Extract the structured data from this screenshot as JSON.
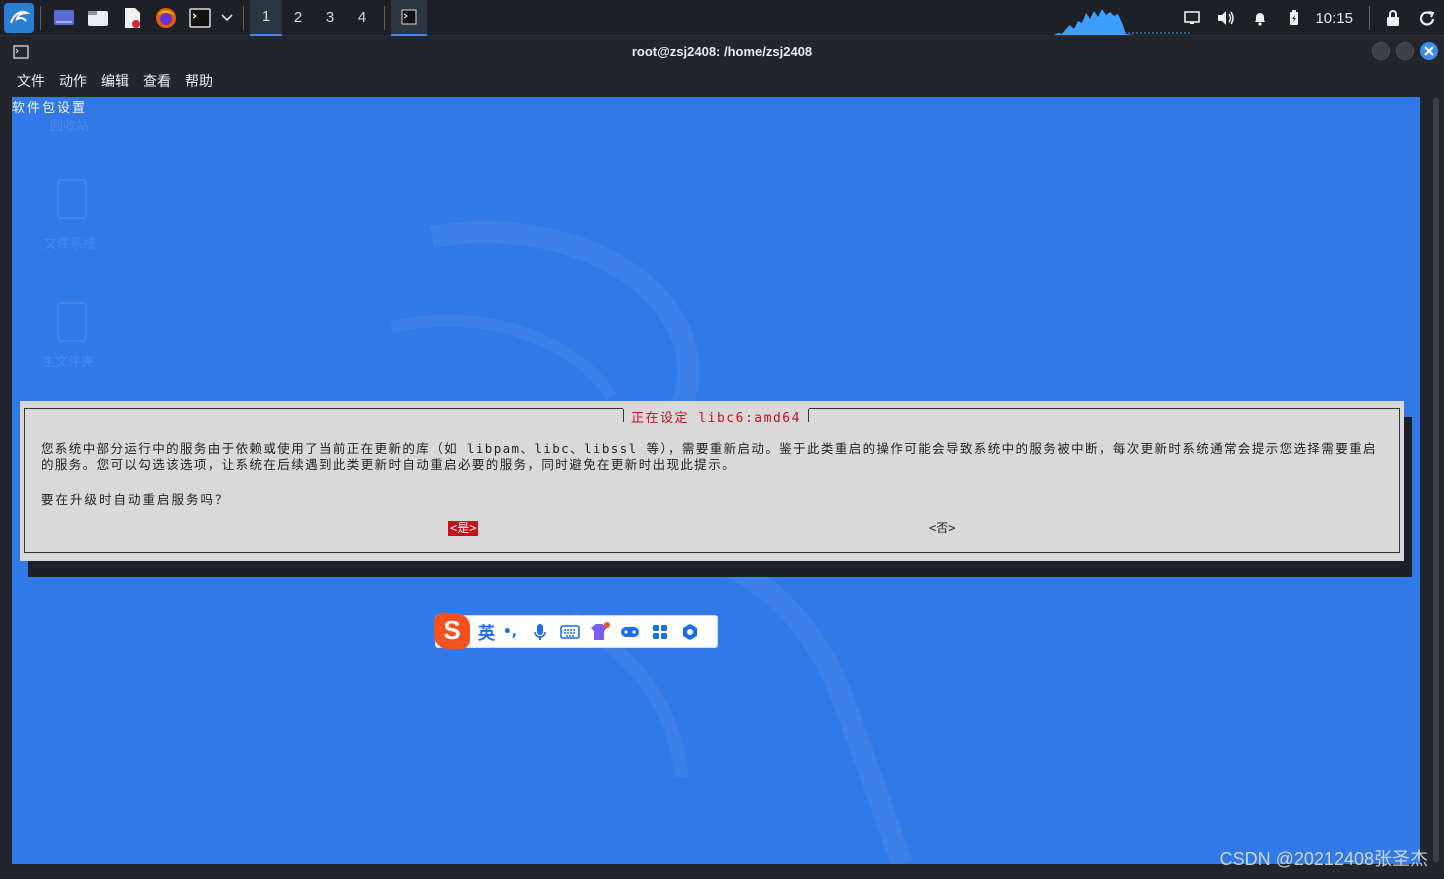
{
  "taskbar": {
    "workspaces": [
      "1",
      "2",
      "3",
      "4"
    ],
    "active_workspace": "1",
    "clock": "10:15",
    "icons": [
      "kali-menu-icon",
      "show-desktop-icon",
      "file-manager-icon",
      "text-editor-icon",
      "firefox-icon",
      "terminal-icon",
      "chevron-down-icon",
      "network-icon",
      "volume-icon",
      "notification-bell-icon",
      "battery-icon",
      "lock-icon",
      "logout-icon"
    ]
  },
  "window": {
    "title": "root@zsj2408: /home/zsj2408",
    "menu": [
      "文件",
      "动作",
      "编辑",
      "查看",
      "帮助"
    ]
  },
  "terminal": {
    "header": "软件包设置",
    "ghost_desktop": [
      "回收站",
      "文件系统",
      "主文件夹"
    ],
    "background_color": "#3279e8"
  },
  "dialog": {
    "title": "正在设定 libc6:amd64",
    "body": "您系统中部分运行中的服务由于依赖或使用了当前正在更新的库（如 libpam、libc、libssl 等），需要重新启动。鉴于此类重启的操作可能会导致系统中的服务被中断，每次更新时系统通常会提示您选择需要重启的服务。您可以勾选该选项，让系统在后续遇到此类更新时自动重启必要的服务，同时避免在更新时出现此提示。",
    "question": "要在升级时自动重启服务吗？",
    "yes": "<是>",
    "no": "<否>",
    "title_color": "#c8101b",
    "selected_button_color": "#c8101b"
  },
  "ime": {
    "logo": "S",
    "lang": "英",
    "punct": "•,",
    "icons": [
      "microphone-icon",
      "keyboard-icon",
      "skin-icon",
      "gamepad-icon",
      "toolbox-icon",
      "settings-icon"
    ]
  },
  "watermark": "CSDN @20212408张圣杰"
}
